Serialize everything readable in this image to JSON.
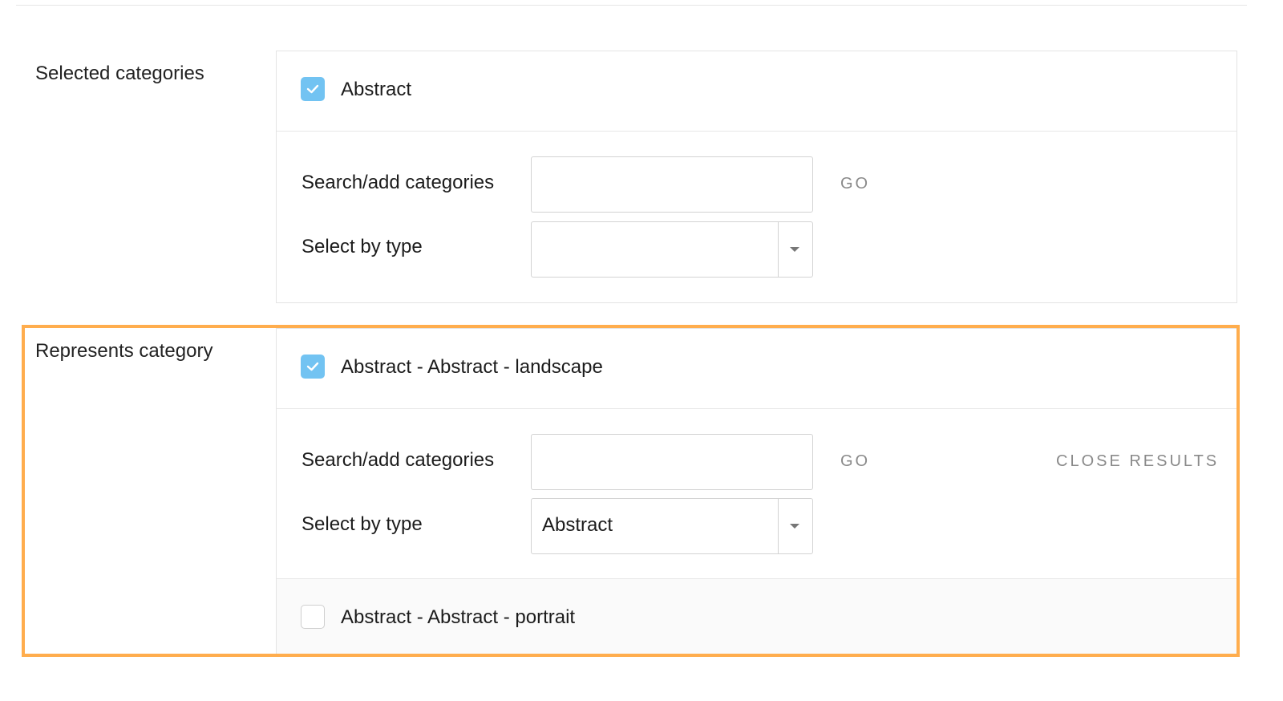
{
  "selected_categories": {
    "label": "Selected categories",
    "checked_item": {
      "label": "Abstract",
      "checked": true
    },
    "search_label": "Search/add categories",
    "search_value": "",
    "go_label": "GO",
    "type_label": "Select by type",
    "type_value": ""
  },
  "represents_category": {
    "label": "Represents category",
    "checked_item": {
      "label": "Abstract - Abstract - landscape",
      "checked": true
    },
    "search_label": "Search/add categories",
    "search_value": "",
    "go_label": "GO",
    "close_results_label": "CLOSE RESULTS",
    "type_label": "Select by type",
    "type_value": "Abstract",
    "results": [
      {
        "label": "Abstract - Abstract - portrait",
        "checked": false
      }
    ]
  },
  "colors": {
    "checkbox_checked": "#72c3f2",
    "highlight": "#ffad4d"
  },
  "icons": {
    "check": "check-icon",
    "caret": "caret-down-icon"
  }
}
